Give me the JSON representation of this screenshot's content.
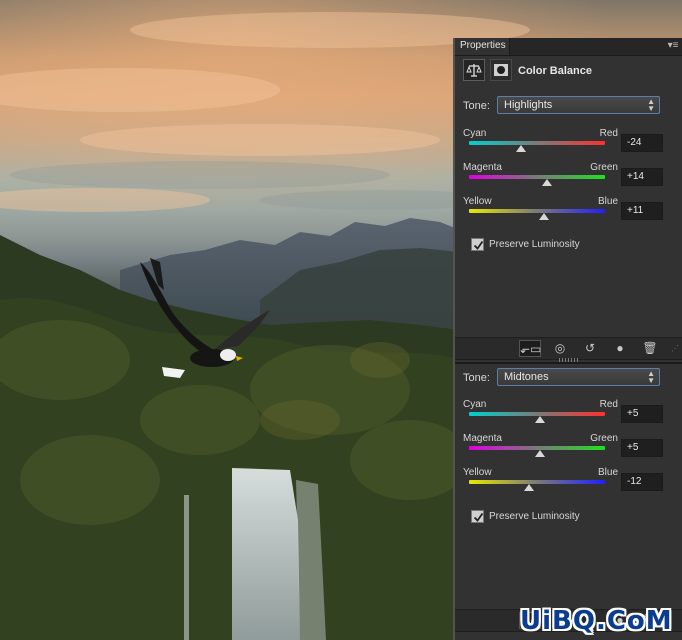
{
  "panel": {
    "tab_label": "Properties",
    "menu_icon": "panel-menu-icon",
    "title": "Color Balance",
    "adjustment_icon": "color-balance-scales-icon",
    "mask_icon": "layer-mask-icon"
  },
  "highlights": {
    "tone_label": "Tone:",
    "tone_value": "Highlights",
    "sliders": [
      {
        "left": "Cyan",
        "right": "Red",
        "value": "-24",
        "level": -24
      },
      {
        "left": "Magenta",
        "right": "Green",
        "value": "+14",
        "level": 14
      },
      {
        "left": "Yellow",
        "right": "Blue",
        "value": "+11",
        "level": 11
      }
    ],
    "preserve_label": "Preserve Luminosity",
    "preserve_checked": true
  },
  "midtones": {
    "tone_label": "Tone:",
    "tone_value": "Midtones",
    "sliders": [
      {
        "left": "Cyan",
        "right": "Red",
        "value": "+5",
        "level": 5
      },
      {
        "left": "Magenta",
        "right": "Green",
        "value": "+5",
        "level": 5
      },
      {
        "left": "Yellow",
        "right": "Blue",
        "value": "-12",
        "level": -12
      }
    ],
    "preserve_label": "Preserve Luminosity",
    "preserve_checked": true
  },
  "footer_icons": [
    "clip-to-layer-icon",
    "toggle-visibility-eye-icon",
    "reset-icon",
    "view-previous-state-icon",
    "delete-icon"
  ],
  "watermark": "UiBQ.CoM",
  "colors": {
    "panel_bg": "#323232",
    "accent_focus": "#5b7fa9",
    "watermark": "#0b3d8f"
  }
}
